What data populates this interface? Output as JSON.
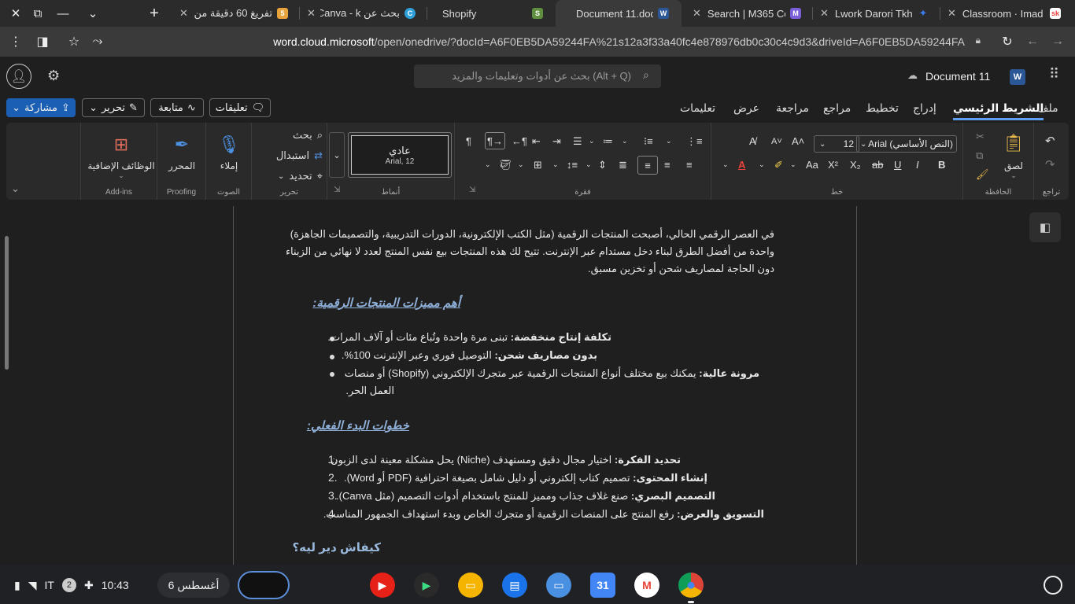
{
  "browser": {
    "tabs": [
      {
        "title": "تفريغ 60 دقيقة من",
        "favicon": "5",
        "color": "#e8a33d"
      },
      {
        "title": "بحث عن Canva - k",
        "favicon": "C",
        "color": "#2d9fd9"
      },
      {
        "title": "Shopify",
        "favicon": "S",
        "color": "#5e8e3e"
      },
      {
        "title": "Document 11.doc",
        "favicon": "W",
        "color": "#2b5797"
      },
      {
        "title": "Search | M365 Co",
        "favicon": "M",
        "color": "#7b5fd9"
      },
      {
        "title": "Lwork Darori Tkhi",
        "favicon": "✦",
        "color": "#3d7be8"
      },
      {
        "title": "Classroom · Imad",
        "favicon": "sk",
        "color": "#e8443d"
      }
    ],
    "new_tab": "+",
    "url_host": "word.cloud.microsoft",
    "url_path": "/open/onedrive/?docId=A6F0EB5DA59244FA%21s12a3f33a40fc4e878976db0c30c4c9d3&driveId=A6F0EB5DA59244FA"
  },
  "office": {
    "doc_title": "Document 11",
    "search_placeholder": "بحث عن أدوات وتعليمات والمزيد (Alt + Q)",
    "share": "مشاركة",
    "edit": "تحرير",
    "follow": "متابعة",
    "comments": "تعليقات",
    "tabs": [
      "ملف",
      "الشريط الرئيسي",
      "إدراج",
      "تخطيط",
      "مراجع",
      "مراجعة",
      "عرض",
      "تعليمات"
    ]
  },
  "ribbon": {
    "undo_label": "تراجع",
    "clipboard_label": "الحافظة",
    "paste": "لصق",
    "font_name": "Arial (النص الأساسي)",
    "font_size": "12",
    "font_label": "خط",
    "paragraph_label": "فقرة",
    "style_name": "عادي",
    "style_desc": "Arial, 12",
    "styles_label": "أنماط",
    "find": "بحث",
    "replace": "استبدال",
    "select": "تحديد",
    "editing_label": "تحرير",
    "dictate": "إملاء",
    "voice_label": "الصوت",
    "editor": "المحرر",
    "proofing_label": "Proofing",
    "addins": "الوظائف الإضافية",
    "addins_label": "Add-ins"
  },
  "doc": {
    "intro": [
      "في العصر الرقمي الحالي، أصبحت المنتجات الرقمية (مثل الكتب الإلكترونية، الدورات التدريبية، والتصميمات الجاهزة)",
      "واحدة من أفضل الطرق لبناء دخل مستدام عبر الإنترنت. تتيح لك هذه المنتجات بيع نفس المنتج لعدد لا نهائي من الزبناء",
      "دون الحاجة لمصاريف شحن أو تخزين مسبق."
    ],
    "heading1": "أهم مميزات المنتجات الرقمية:",
    "bullets": [
      {
        "bold": "تكلفة إنتاج منخفضة:",
        "text": " تبنى مرة واحدة وتُباع مئات أو آلاف المرات."
      },
      {
        "bold": "بدون مصاريف شحن:",
        "text": " التوصيل فوري وعبر الإنترنت 100%."
      },
      {
        "bold": "مرونة عالية:",
        "text": " يمكنك بيع مختلف أنواع المنتجات الرقمية عبر متجرك الإلكتروني (Shopify) أو منصات"
      },
      {
        "bold": "",
        "text": "العمل الحر."
      }
    ],
    "heading2": "خطوات البدء الفعلي:",
    "steps": [
      {
        "n": "1.",
        "bold": "تحديد الفكرة:",
        "text": " اختيار مجال دقيق ومستهدف (Niche) يحل مشكلة معينة لدى الزبون."
      },
      {
        "n": "2.",
        "bold": "إنشاء المحتوى:",
        "text": " تصميم كتاب إلكتروني أو دليل شامل بصيغة احترافية (PDF أو Word)."
      },
      {
        "n": "3.",
        "bold": "التصميم البصري:",
        "text": " صنع غلاف جذاب ومميز للمنتج باستخدام أدوات التصميم (مثل Canva)."
      },
      {
        "n": "4.",
        "bold": "التسويق والعرض:",
        "text": " رفع المنتج على المنصات الرقمية أو متجرك الخاص وبدء استهداف الجمهور المناسب."
      }
    ],
    "heading3": "كيفاش دير ليه؟"
  },
  "shelf": {
    "lang": "IT",
    "notif_count": "2",
    "time": "10:43",
    "date": "6 أغسطس",
    "apps": [
      {
        "name": "youtube",
        "color": "#e62117",
        "glyph": "▶"
      },
      {
        "name": "play-store",
        "color": "#2a2a2a",
        "glyph": "▶"
      },
      {
        "name": "slides",
        "color": "#f4b400",
        "glyph": "▭"
      },
      {
        "name": "chat",
        "color": "#1a73e8",
        "glyph": "▤"
      },
      {
        "name": "files",
        "color": "#4a90e2",
        "glyph": "▭"
      },
      {
        "name": "calendar",
        "color": "#4285f4",
        "glyph": "31"
      },
      {
        "name": "gmail",
        "color": "#ffffff",
        "glyph": "M"
      },
      {
        "name": "chrome",
        "color": "#db4437",
        "glyph": "●"
      }
    ]
  }
}
